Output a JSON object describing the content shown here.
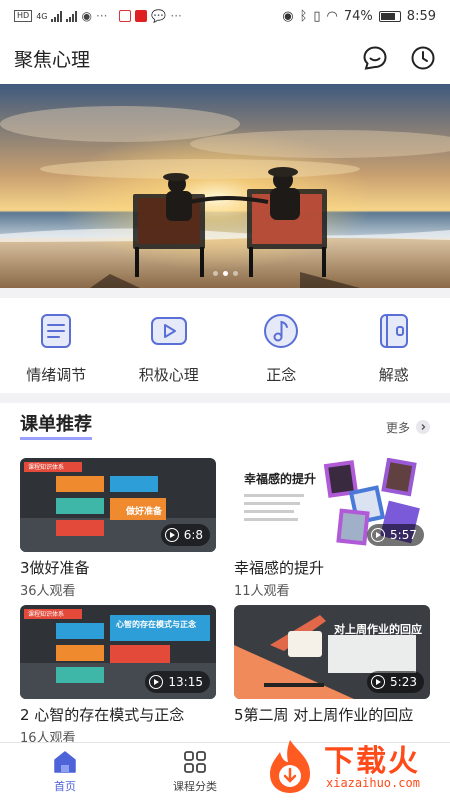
{
  "status_bar": {
    "network": "HD",
    "network_type": "4G",
    "battery": "74%",
    "time": "8:59"
  },
  "header": {
    "title": "聚焦心理",
    "icons": [
      "message-icon",
      "clock-icon"
    ]
  },
  "banner": {
    "slide_count": 3,
    "active_slide": 1
  },
  "categories": [
    {
      "label": "情绪调节",
      "icon": "document-icon"
    },
    {
      "label": "积极心理",
      "icon": "video-play-icon"
    },
    {
      "label": "正念",
      "icon": "music-note-icon"
    },
    {
      "label": "解惑",
      "icon": "notebook-icon"
    }
  ],
  "section": {
    "title": "课单推荐",
    "more_label": "更多"
  },
  "courses": [
    {
      "title": "3做好准备",
      "views": "36人观看",
      "duration": "6:8",
      "thumb_text": "做好准备",
      "thumb_tag": "课程知识体系"
    },
    {
      "title": "幸福感的提升",
      "views": "11人观看",
      "duration": "5:57",
      "thumb_text": "幸福感的提升"
    },
    {
      "title": "2 心智的存在模式与正念",
      "views": "16人观看",
      "duration": "13:15",
      "thumb_text": "心智的存在模式与正念",
      "thumb_tag": "课程知识体系"
    },
    {
      "title": "5第二周 对上周作业的回应",
      "views": "",
      "duration": "5:23",
      "thumb_text": "对上周作业的回应"
    }
  ],
  "bottom_nav": [
    {
      "label": "首页",
      "active": true
    },
    {
      "label": "课程分类",
      "active": false
    }
  ],
  "watermark": {
    "text": "下载火",
    "sub": "xiazaihuo.com"
  },
  "colors": {
    "accent": "#4f63d8",
    "watermark": "#ff4a1a",
    "icon_blue": "#5a6fd6"
  }
}
